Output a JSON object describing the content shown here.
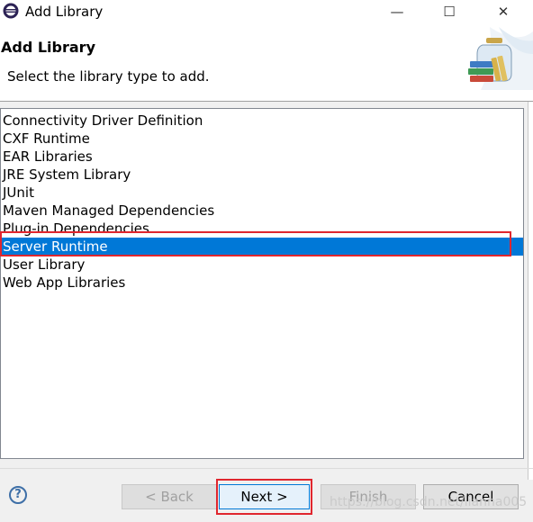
{
  "window": {
    "title": "Add Library",
    "icon": "eclipse-icon",
    "controls": {
      "minimize_glyph": "—",
      "maximize_glyph": "☐",
      "close_glyph": "✕"
    }
  },
  "header": {
    "title": "Add Library",
    "description": "Select the library type to add.",
    "art_icon": "library-jar-books-icon"
  },
  "library_types": {
    "items": [
      {
        "label": "Connectivity Driver Definition",
        "selected": false
      },
      {
        "label": "CXF Runtime",
        "selected": false
      },
      {
        "label": "EAR Libraries",
        "selected": false
      },
      {
        "label": "JRE System Library",
        "selected": false
      },
      {
        "label": "JUnit",
        "selected": false
      },
      {
        "label": "Maven Managed Dependencies",
        "selected": false
      },
      {
        "label": "Plug-in Dependencies",
        "selected": false
      },
      {
        "label": "Server Runtime",
        "selected": true
      },
      {
        "label": "User Library",
        "selected": false
      },
      {
        "label": "Web App Libraries",
        "selected": false
      }
    ]
  },
  "footer": {
    "help_glyph": "?",
    "back_label": "< Back",
    "next_label": "Next >",
    "finish_label": "Finish",
    "cancel_label": "Cancel",
    "watermark": "https://blog.csdn.net/lianna005"
  },
  "colors": {
    "selection": "#0078d7",
    "highlight": "#e0262e"
  }
}
